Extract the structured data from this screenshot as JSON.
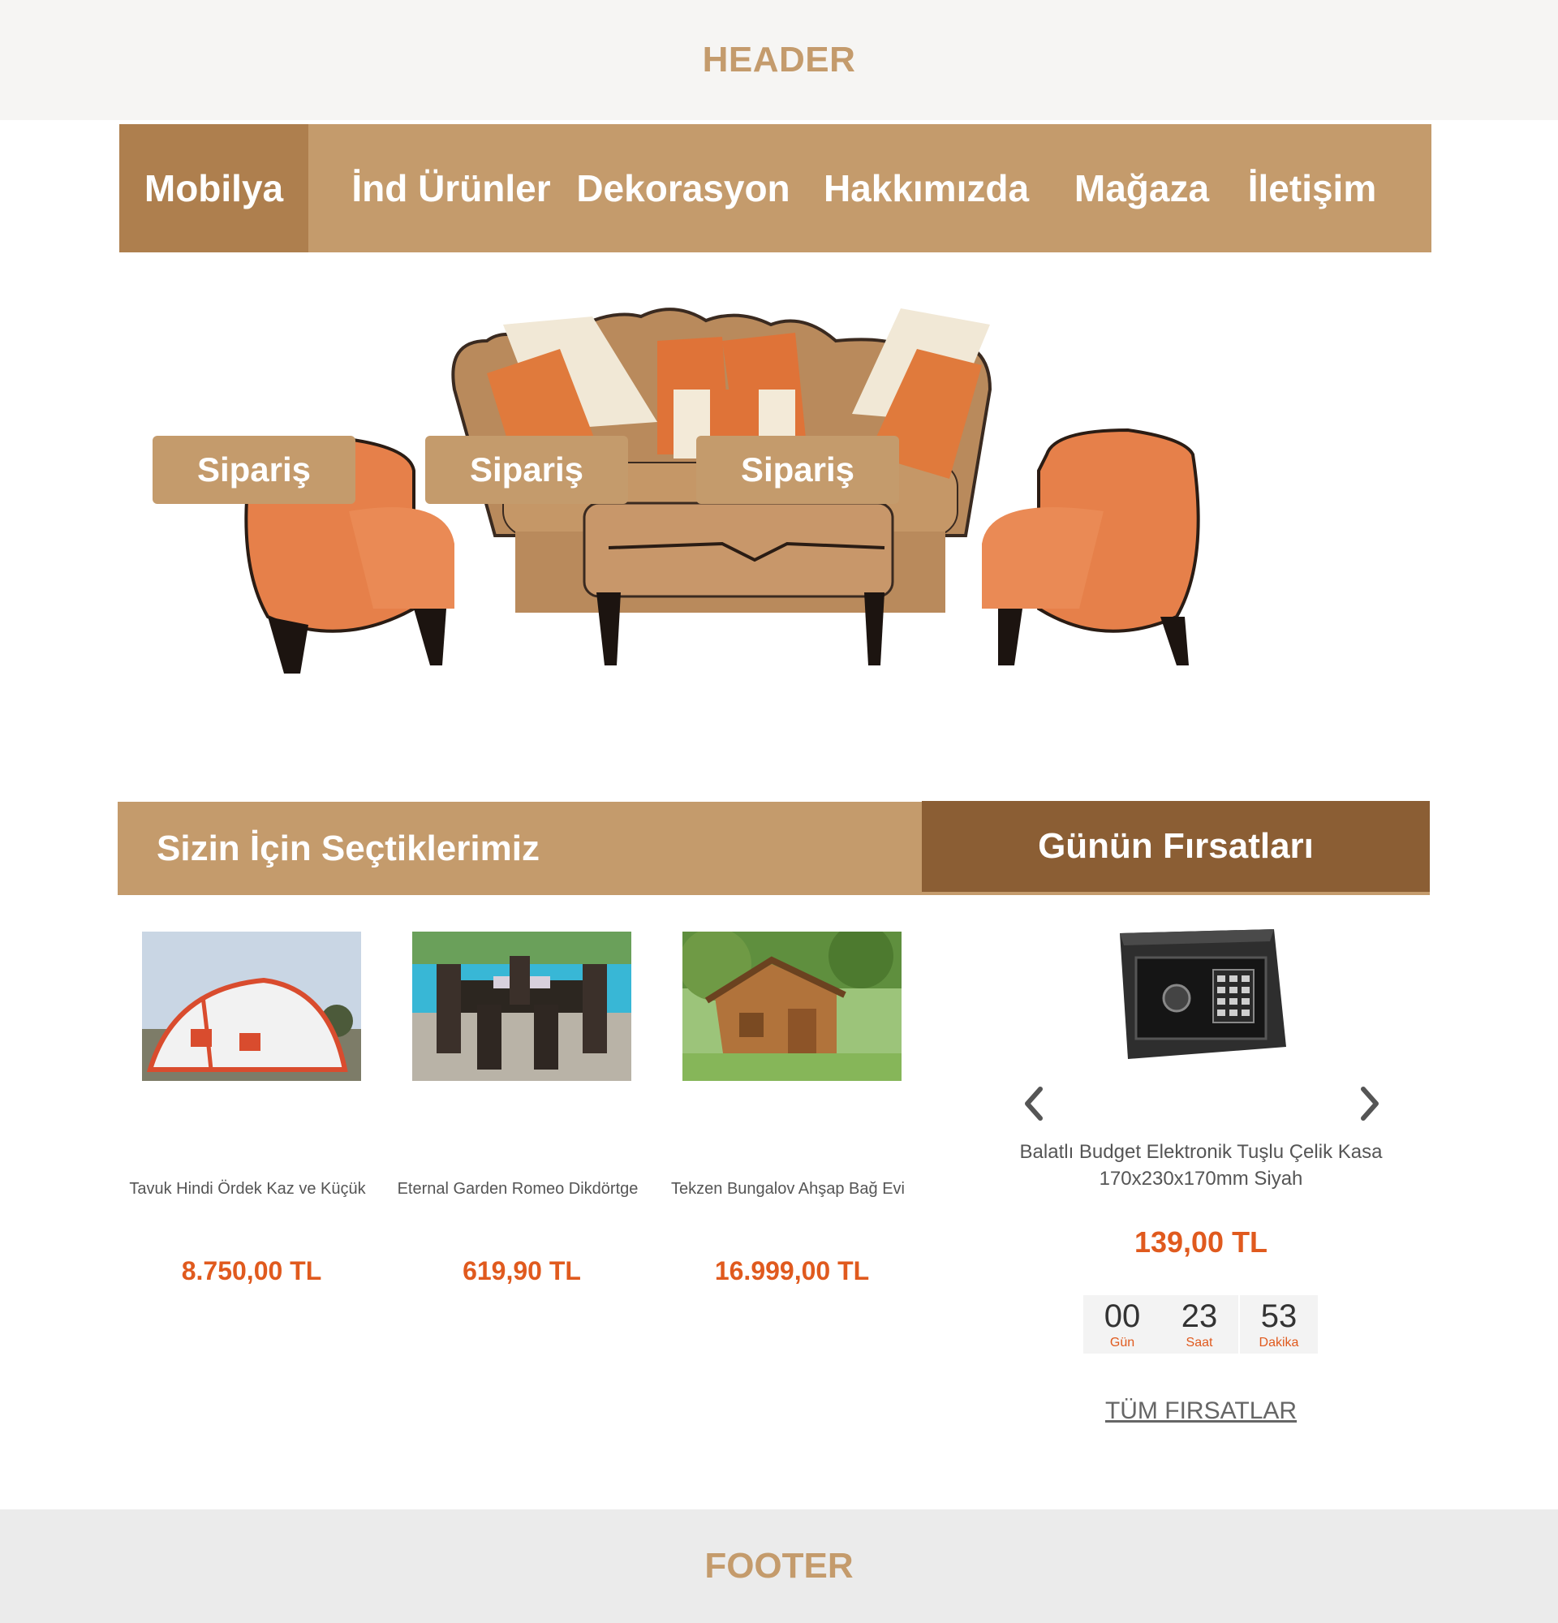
{
  "header": {
    "label": "HEADER"
  },
  "nav": {
    "items": [
      {
        "label": "Mobilya",
        "active": true
      },
      {
        "label": "İnd Ürünler",
        "active": false
      },
      {
        "label": "Dekorasyon",
        "active": false
      },
      {
        "label": "Hakkımızda",
        "active": false
      },
      {
        "label": "Mağaza",
        "active": false
      },
      {
        "label": "İletişim",
        "active": false
      }
    ]
  },
  "sections": {
    "picks_title": "Sizin İçin Seçtiklerimiz",
    "deals_title": "Günün Fırsatları"
  },
  "products": [
    {
      "name": "Tavuk Hindi Ördek Kaz ve Küçük",
      "price": "8.750,00 TL",
      "button": "Sipariş",
      "image": "tent-photo"
    },
    {
      "name": "Eternal Garden Romeo Dikdörtge",
      "price": "619,90 TL",
      "button": "Sipariş",
      "image": "garden-furniture-photo"
    },
    {
      "name": "Tekzen Bungalov Ahşap Bağ Evi",
      "price": "16.999,00 TL",
      "button": "Sipariş",
      "image": "wooden-bungalow-photo"
    }
  ],
  "deal": {
    "name": "Balatlı Budget Elektronik Tuşlu Çelik Kasa 170x230x170mm Siyah",
    "price": "139,00 TL",
    "image": "steel-safe-photo",
    "countdown": [
      {
        "value": "00",
        "label": "Gün"
      },
      {
        "value": "23",
        "label": "Saat"
      },
      {
        "value": "53",
        "label": "Dakika"
      }
    ],
    "all_link": "TÜM FIRSATLAR"
  },
  "footer": {
    "label": "FOOTER"
  },
  "colors": {
    "accent": "#c49b6c",
    "accent_dark": "#ae7f4e",
    "deal_header": "#8b5e34",
    "price": "#e05a1e",
    "header_bg": "#f6f5f3",
    "footer_bg": "#ebebeb"
  }
}
